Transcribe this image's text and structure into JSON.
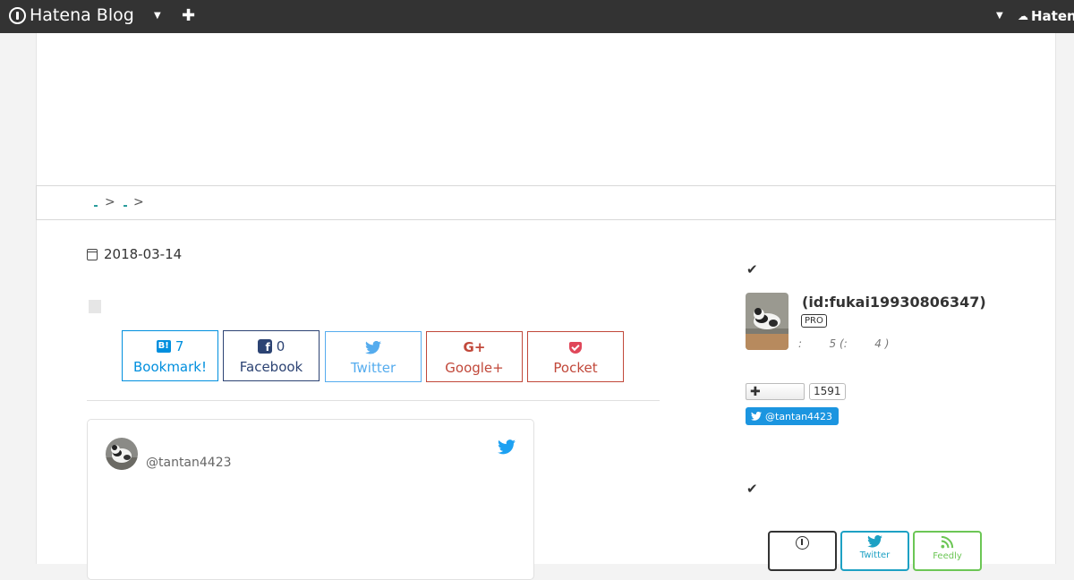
{
  "topbar": {
    "brand": "Hatena Blog",
    "right_brand": "Haten",
    "icons": [
      "hatena-logo-icon",
      "caret-down-icon",
      "plus-icon",
      "hatena-mark-icon"
    ]
  },
  "breadcrumb": {
    "separators": [
      ">",
      ">"
    ]
  },
  "article": {
    "date": "2018-03-14",
    "share": {
      "bookmark": {
        "count": "7",
        "label": "Bookmark!"
      },
      "facebook": {
        "count": "0",
        "label": "Facebook"
      },
      "twitter": {
        "label": "Twitter"
      },
      "google": {
        "icon_text": "G+",
        "label": "Google+"
      },
      "pocket": {
        "label": "Pocket"
      }
    },
    "tweet": {
      "handle": "@tantan4423"
    }
  },
  "sidebar": {
    "profile": {
      "id": "(id:fukai19930806347)",
      "badge": "PRO",
      "stats": ":        5 (:        4 )"
    },
    "follow": {
      "count": "1591"
    },
    "twitter_follow": {
      "label": "@tantan4423"
    },
    "subscribe": {
      "twitter_label": "Twitter",
      "feedly_label": "Feedly"
    }
  },
  "colors": {
    "topbar": "#333333",
    "bookmark": "#008fde",
    "facebook": "#2c4373",
    "twitter": "#55acee",
    "google": "#c1483a",
    "pocket": "#c1483a",
    "twitter_follow": "#1b95e0",
    "feedly": "#6cc655"
  }
}
